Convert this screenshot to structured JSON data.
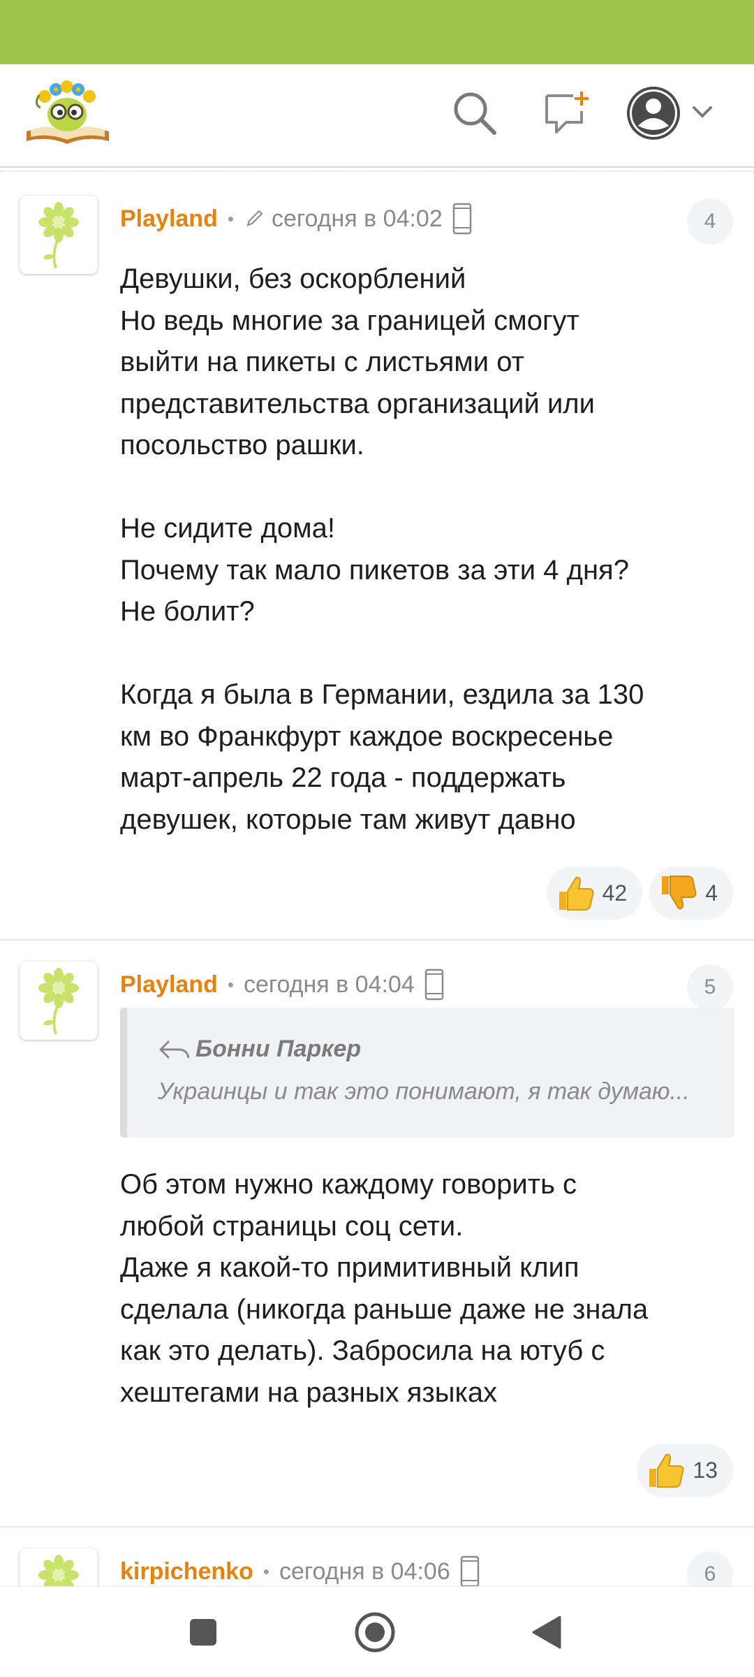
{
  "header": {
    "logo_icon": "flower-wreath-bookworm-logo",
    "search_icon": "search-icon",
    "new_topic_icon": "new-message-icon",
    "profile_icon": "user-avatar-icon",
    "accent": "#9ac548",
    "brand_orange": "#e8820c"
  },
  "comments": [
    {
      "author": "Playland",
      "edited": true,
      "time": "сегодня в 04:02",
      "number": "4",
      "paragraphs": [
        [
          "Девушки, без оскорблений",
          "Но ведь многие за границей смогут",
          "выйти на пикеты с листьями от",
          "представительства организаций или",
          "посольство рашки."
        ],
        [
          "Не сидите дома!",
          "Почему так мало пикетов за эти 4 дня?",
          "Не болит?"
        ],
        [
          "Когда я была в Германии, ездила за 130",
          "км во Франкфурт каждое воскресенье",
          "март-апрель 22 года - поддержать",
          "девушек, которые там живут давно"
        ]
      ],
      "likes": "42",
      "dislikes": "4"
    },
    {
      "author": "Playland",
      "time": "сегодня в 04:04",
      "number": "5",
      "quote": {
        "author": "Бонни Паркер",
        "text": "Украинцы и так это понимают, я так думаю..."
      },
      "paragraphs": [
        [
          "Об этом нужно каждому говорить с",
          "любой страницы соц сети.",
          "Даже я какой-то примитивный клип",
          "сделала (никогда раньше даже не знала",
          "как это делать). Забросила на ютуб с",
          "хештегами на разных языках"
        ]
      ],
      "likes": "13"
    },
    {
      "author": "kirpichenko",
      "time": "сегодня в 04:06",
      "number": "6"
    }
  ]
}
